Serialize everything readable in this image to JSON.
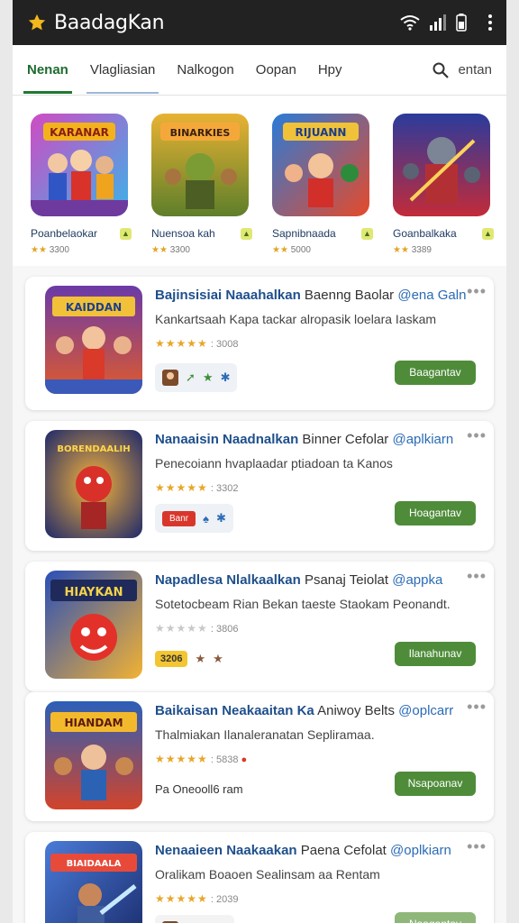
{
  "app": {
    "title": "BaadagKan",
    "accent": "#1f7a34",
    "logo_icon": "star-icon",
    "status_icons": [
      "wifi-icon",
      "signal-icon",
      "battery-icon",
      "overflow-menu-icon"
    ]
  },
  "tabs": [
    {
      "label": "Nenan",
      "active": true
    },
    {
      "label": "Vlagliasian",
      "active": false
    },
    {
      "label": "Nalkogon",
      "active": false
    },
    {
      "label": "Oopan",
      "active": false
    },
    {
      "label": "Hpy",
      "active": false
    }
  ],
  "search": {
    "label": "entan",
    "icon": "search-icon"
  },
  "featured": [
    {
      "name": "Poanbelaokar",
      "meta": "3300",
      "art": "KARANAR"
    },
    {
      "name": "Nuensoa kah",
      "meta": "3300",
      "art": "BINARKIES"
    },
    {
      "name": "Sapnibnaada",
      "meta": "5000",
      "art": "RIJUANN"
    },
    {
      "name": "Goanbalkaka",
      "meta": "3389",
      "art": ""
    }
  ],
  "cards": [
    {
      "title_bold": "Bajinsisiai Naaahalkan",
      "title_plain": "Baenng Baolar",
      "handle": "@ena Galn",
      "desc": "Kankartsaah Kapa tackar alropasik loelara Iaskam",
      "rating": "3008",
      "stars_active": true,
      "art": "KAIDDAN",
      "chips": [
        "avatar",
        "arrow-star",
        "blue-star"
      ],
      "install_label": "Baagantav"
    },
    {
      "title_bold": "Nanaaisin Naadnalkan",
      "title_plain": "Binner Cefolar",
      "handle": "@aplkiarn",
      "desc": "Penecoiann hvaplaadar ptiadoan ta Kanos",
      "rating": "3302",
      "stars_active": true,
      "art": "BORENDAALIH",
      "tag_label": "Banr",
      "chips": [
        "tag",
        "drop",
        "blue-star"
      ],
      "install_label": "Hoagantav"
    },
    {
      "title_bold": "Napadlesa Nlalkaalkan",
      "title_plain": "Psanaj Teiolat",
      "handle": "@appka",
      "desc": "Sotetocbeam Rian Bekan taeste Staokam Peonandt.",
      "rating": "3806",
      "stars_active": false,
      "art": "HIAYKAN",
      "gold_label": "3206",
      "chips": [
        "gold",
        "star",
        "star"
      ],
      "install_label": "Ilanahunav"
    },
    {
      "title_bold": "Baikaisan Neakaaitan Ka",
      "title_plain": "Aniwoy Belts",
      "handle": "@oplcarr",
      "desc": "Thalmiakan Ilanaleranatan Sepliramaa.",
      "rating": "5838",
      "stars_active": true,
      "art": "HIANDAM",
      "chip_text": "Pa Oneooll6 ram",
      "chips": [
        "text"
      ],
      "install_label": "Nsapoanav"
    },
    {
      "title_bold": "Nenaaieen Naakaakan",
      "title_plain": "Paena Cefolat",
      "handle": "@oplkiarn",
      "desc": "Oralikam Boaoen Sealinsam aa Rentam",
      "rating": "2039",
      "stars_active": true,
      "art": "BIAIDAALA",
      "chip_text": "bialaner",
      "chips": [
        "avatar-text"
      ],
      "install_label": "Naagantav",
      "install_light": true
    }
  ]
}
